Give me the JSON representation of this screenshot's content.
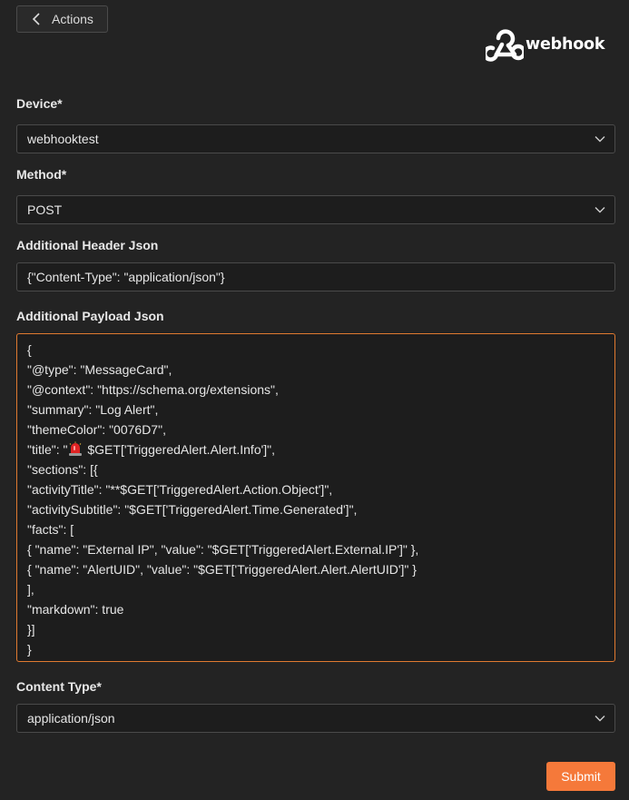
{
  "header": {
    "back_label": "Actions",
    "logo_text": "webhook"
  },
  "form": {
    "device": {
      "label": "Device*",
      "value": "webhooktest"
    },
    "method": {
      "label": "Method*",
      "value": "POST"
    },
    "header_json": {
      "label": "Additional Header Json",
      "value": "{\"Content-Type\": \"application/json\"}"
    },
    "payload_json": {
      "label": "Additional Payload Json",
      "lines": [
        "{",
        "\"@type\": \"MessageCard\",",
        "\"@context\": \"https://schema.org/extensions\",",
        "\"summary\": \"Log Alert\",",
        "\"themeColor\": \"0076D7\",",
        "\"title\": \"",
        "\"sections\": [{",
        "\"activityTitle\": \"**$GET['TriggeredAlert.Action.Object']\",",
        "\"activitySubtitle\": \"$GET['TriggeredAlert.Time.Generated']\",",
        "\"facts\": [",
        "{ \"name\": \"External IP\", \"value\": \"$GET['TriggeredAlert.External.IP']\" },",
        "{ \"name\": \"AlertUID\", \"value\": \"$GET['TriggeredAlert.Alert.AlertUID']\" }",
        "],",
        "\"markdown\": true",
        "}]",
        "}"
      ],
      "title_line_suffix": " $GET['TriggeredAlert.Alert.Info']\","
    },
    "content_type": {
      "label": "Content Type*",
      "value": "application/json"
    },
    "submit_label": "Submit"
  },
  "colors": {
    "background": "#232323",
    "accent": "#f5793a",
    "focus_border": "#e07a30"
  },
  "icons": {
    "back": "chevron-left-icon",
    "logo": "webhook-logo-icon",
    "dropdown": "chevron-down-icon",
    "alert": "rotating-light-icon"
  }
}
